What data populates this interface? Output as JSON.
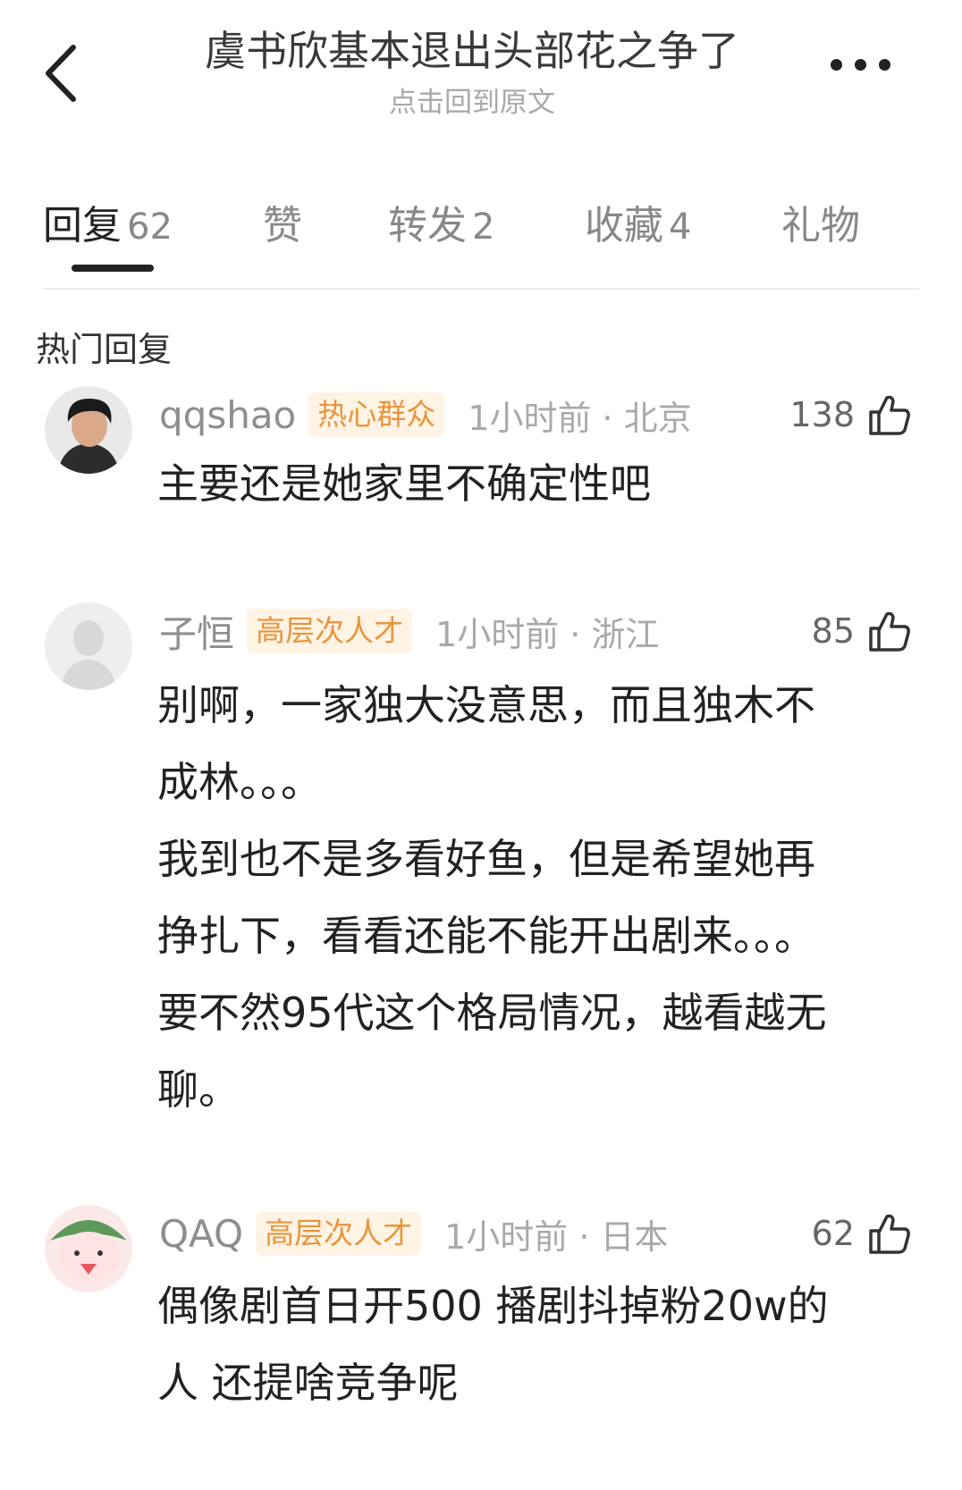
{
  "header": {
    "title": "虞书欣基本退出头部花之争了",
    "subtitle": "点击回到原文",
    "back_icon": "chevron-left-icon",
    "more_icon": "more-dots-icon"
  },
  "tabs": [
    {
      "label": "回复",
      "count": "62",
      "active": true
    },
    {
      "label": "赞",
      "count": "",
      "active": false
    },
    {
      "label": "转发",
      "count": "2",
      "active": false
    },
    {
      "label": "收藏",
      "count": "4",
      "active": false
    },
    {
      "label": "礼物",
      "count": "",
      "active": false
    }
  ],
  "section_title": "热门回复",
  "comments": [
    {
      "username": "qqshao",
      "badge": "热心群众",
      "time_loc": "1小时前 · 北京",
      "likes": "138",
      "lines": [
        "主要还是她家里不确定性吧"
      ]
    },
    {
      "username": "子恒",
      "badge": "高层次人才",
      "time_loc": "1小时前 · 浙江",
      "likes": "85",
      "lines": [
        "别啊，一家独大没意思，而且独木不",
        "成林。。。",
        "我到也不是多看好鱼，但是希望她再",
        "挣扎下，看看还能不能开出剧来。。。",
        "要不然95代这个格局情况，越看越无",
        "聊。"
      ]
    },
    {
      "username": "QAQ",
      "badge": "高层次人才",
      "time_loc": "1小时前 · 日本",
      "likes": "62",
      "lines": [
        "偶像剧首日开500 播剧抖掉粉20w的",
        "人 还提啥竞争呢"
      ]
    }
  ],
  "colors": {
    "badge_bg": "#fff3e4",
    "badge_text": "#e9953e",
    "active_tab": "#222222",
    "muted": "#a9a9a9"
  }
}
